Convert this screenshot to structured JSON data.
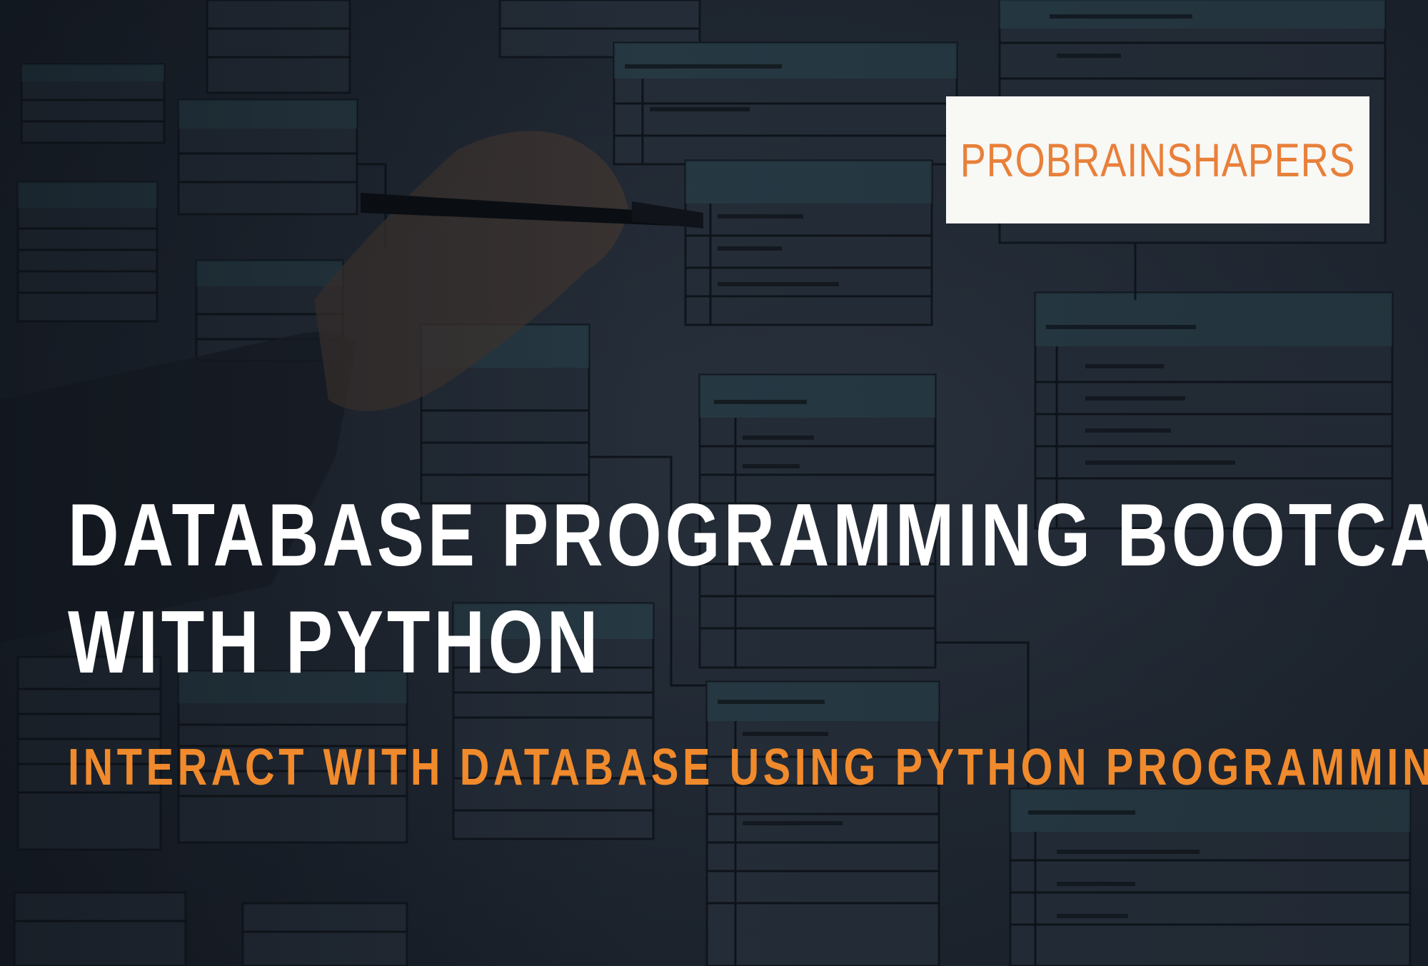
{
  "brand": {
    "name": "PROBRAINSHAPERS"
  },
  "headline": {
    "line1": "DATABASE PROGRAMMING BOOTCAMP",
    "line2": "WITH PYTHON"
  },
  "tagline": "INTERACT WITH DATABASE USING PYTHON PROGRAMMING",
  "colors": {
    "accent_orange": "#f08a2c",
    "headline_white": "#ffffff",
    "brand_box": "#f8f8f5",
    "background": "#222a35"
  }
}
